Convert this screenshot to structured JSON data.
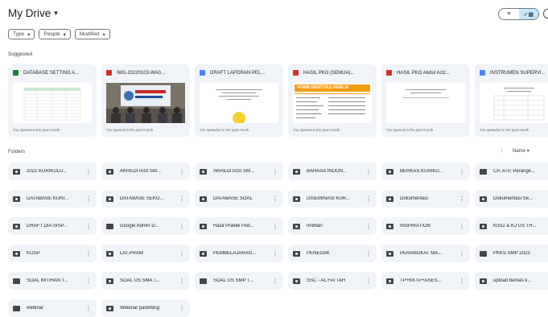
{
  "header": {
    "title": "My Drive",
    "caret": "▾"
  },
  "view": {
    "list_icon": "list-icon",
    "grid_icon": "grid-icon",
    "check": "✓",
    "grid_glyph": "▦",
    "list_glyph": "≡"
  },
  "filters": [
    {
      "label": "Type",
      "caret": "▾"
    },
    {
      "label": "People",
      "caret": "▾"
    },
    {
      "label": "Modified",
      "caret": "▾"
    }
  ],
  "suggested": {
    "heading": "Suggested",
    "cards": [
      {
        "name": "DATABASE SETTING A...",
        "color": "#188038",
        "activity": "You opened in the past month"
      },
      {
        "name": "IMG-20220103-WA0...",
        "color": "#d93025",
        "activity": "You opened in the past month"
      },
      {
        "name": "DRAFT LAPORAN PEL...",
        "color": "#4285f4",
        "activity": "You uploaded in the past month"
      },
      {
        "name": "HASIL PKG (SEMUA)...",
        "color": "#d93025",
        "activity": "You opened in the past month"
      },
      {
        "name": "HASIL PKG Abdul Aziz...",
        "color": "#d93025",
        "activity": "You opened in the past month"
      },
      {
        "name": "INSTRUMEN SUPERVI...",
        "color": "#4285f4",
        "activity": "You uploaded in the past month"
      }
    ],
    "thumb_img_text": "SMP NEGERI",
    "thumb_form_text": "FORM IDENTITAS PENILAI"
  },
  "folders": {
    "heading": "Folders",
    "sort_arrow": "↑",
    "sort_label": "Name",
    "sort_caret": "▾",
    "items": [
      {
        "name": "2022 KURIKULU...",
        "shared": true
      },
      {
        "name": "AKREDITASI SM...",
        "shared": true
      },
      {
        "name": "AKREDITASI SM...",
        "shared": true
      },
      {
        "name": "BAHASA INDON...",
        "shared": true
      },
      {
        "name": "BERKAS KURIKU...",
        "shared": true
      },
      {
        "name": "CP, ATP, Perangk...",
        "shared": false
      },
      {
        "name": "DATABASE KURI...",
        "shared": true
      },
      {
        "name": "DATABASE SEKO...",
        "shared": true
      },
      {
        "name": "DATABASE SOAL",
        "shared": true
      },
      {
        "name": "DISEMINASI KUR...",
        "shared": true
      },
      {
        "name": "Dokumentasi",
        "shared": true
      },
      {
        "name": "Dokumentasi Se...",
        "shared": true
      },
      {
        "name": "DRAFT DIA SISP...",
        "shared": true
      },
      {
        "name": "Google Admin D...",
        "shared": false
      },
      {
        "name": "Hasil Praktik Pxd...",
        "shared": true
      },
      {
        "name": "Imtihan",
        "shared": true
      },
      {
        "name": "INSPIRATION",
        "shared": true
      },
      {
        "name": "KISI2 & KJ US TH...",
        "shared": true
      },
      {
        "name": "KOSP",
        "shared": true
      },
      {
        "name": "LAT.PRAM",
        "shared": true
      },
      {
        "name": "PEMBELAJARAN...",
        "shared": true
      },
      {
        "name": "PENEGAK",
        "shared": true
      },
      {
        "name": "PERANGKAT MA...",
        "shared": true
      },
      {
        "name": "PKKS SMP 2023",
        "shared": false
      },
      {
        "name": "SOAL IMTIHAN T...",
        "shared": false
      },
      {
        "name": "SOAL US SMA T...",
        "shared": true
      },
      {
        "name": "SOAL US SMP T...",
        "shared": false
      },
      {
        "name": "SSC - AL FATTAH",
        "shared": true
      },
      {
        "name": "TP+KKTP+ASES...",
        "shared": true
      },
      {
        "name": "upload berkas k...",
        "shared": true
      },
      {
        "name": "webinar",
        "shared": false
      },
      {
        "name": "Webinar parenting",
        "shared": true
      }
    ]
  }
}
